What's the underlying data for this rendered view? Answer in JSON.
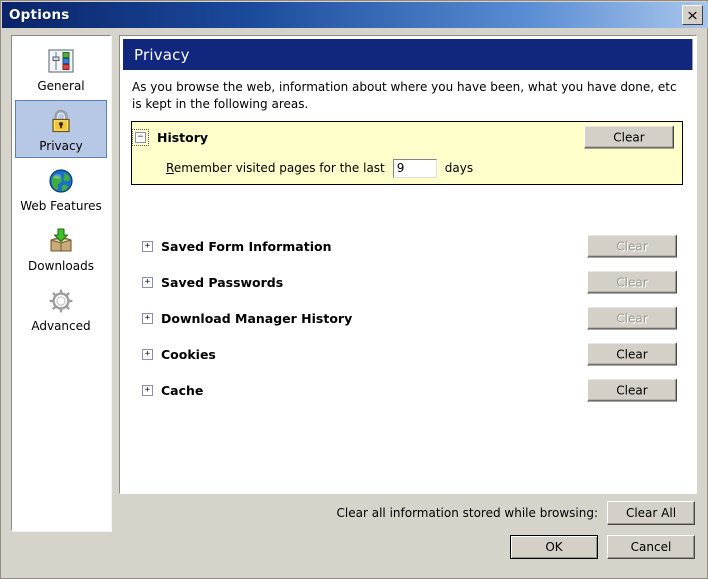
{
  "window": {
    "title": "Options",
    "close_label": "✕"
  },
  "sidebar": {
    "items": [
      {
        "label": "General",
        "icon": "sliders-icon",
        "selected": false
      },
      {
        "label": "Privacy",
        "icon": "padlock-icon",
        "selected": true
      },
      {
        "label": "Web Features",
        "icon": "globe-icon",
        "selected": false
      },
      {
        "label": "Downloads",
        "icon": "download-box-icon",
        "selected": false
      },
      {
        "label": "Advanced",
        "icon": "gear-icon",
        "selected": false
      }
    ]
  },
  "panel": {
    "header_title": "Privacy",
    "intro": "As you browse the web, information about where you have been, what you have done, etc is kept in the following areas."
  },
  "history": {
    "toggle_glyph": "−",
    "label": "History",
    "clear_label": "Clear",
    "sub_prefix_accel": "R",
    "sub_prefix": "emember visited pages for the last",
    "days_value": "9",
    "days_suffix": "days"
  },
  "rows": [
    {
      "toggle_glyph": "+",
      "label": "Saved Form Information",
      "clear_label": "Clear",
      "disabled": true
    },
    {
      "toggle_glyph": "+",
      "label": "Saved Passwords",
      "clear_label": "Clear",
      "disabled": true
    },
    {
      "toggle_glyph": "+",
      "label": "Download Manager History",
      "clear_label": "Clear",
      "disabled": true
    },
    {
      "toggle_glyph": "+",
      "label": "Cookies",
      "clear_label": "Clear",
      "disabled": false
    },
    {
      "toggle_glyph": "+",
      "label": "Cache",
      "clear_label": "Clear",
      "disabled": false
    }
  ],
  "footer": {
    "clear_all_label": "Clear all information stored while browsing:",
    "clear_all_button": "Clear All",
    "ok_label": "OK",
    "cancel_label": "Cancel"
  },
  "colors": {
    "title_bar_start": "#0a246a",
    "title_bar_end": "#a8c6ec",
    "panel_header": "#11277e",
    "history_background": "#ffffcc",
    "dialog_face": "#d6d3cb",
    "selected_item": "#b7c8e6"
  }
}
